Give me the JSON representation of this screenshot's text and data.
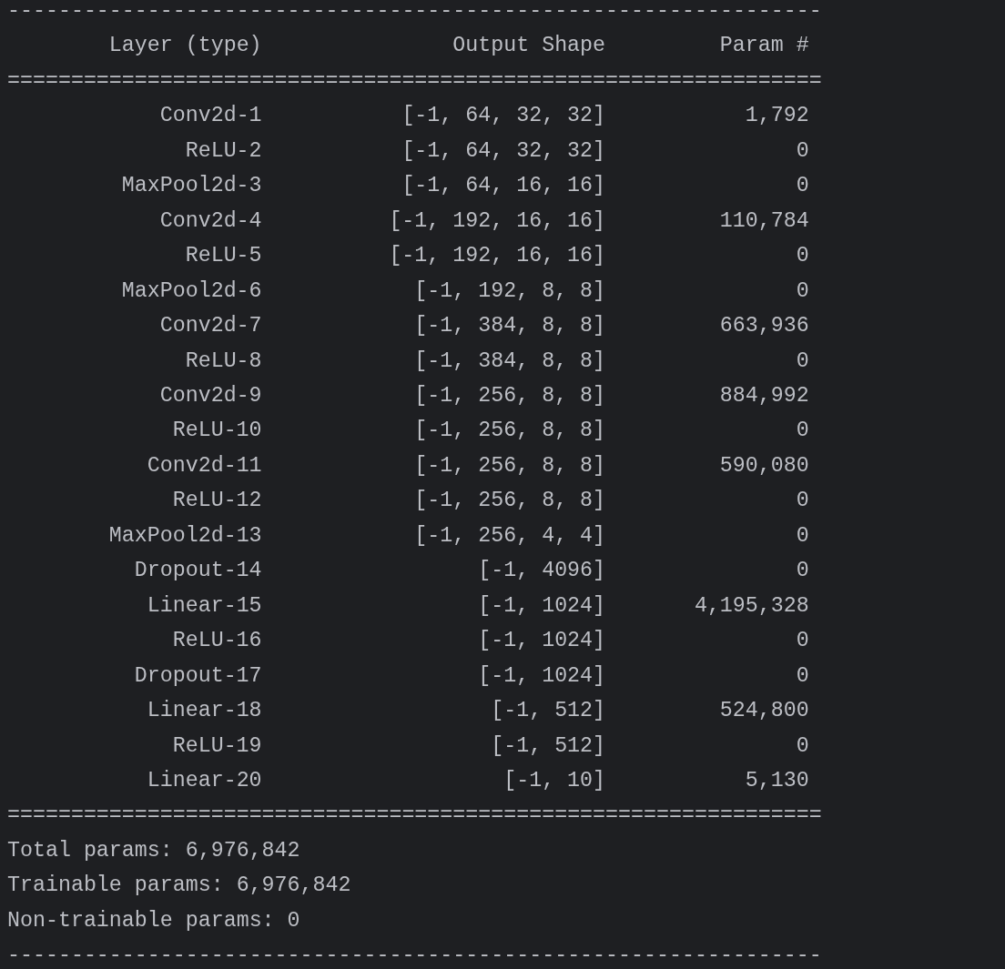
{
  "rule_top": "----------------------------------------------------------------",
  "columns": [
    "Layer (type)",
    "Output Shape",
    "Param #"
  ],
  "rule_header": "================================================================",
  "rows": [
    {
      "layer": "Conv2d-1",
      "shape": "[-1, 64, 32, 32]",
      "params": "1,792"
    },
    {
      "layer": "ReLU-2",
      "shape": "[-1, 64, 32, 32]",
      "params": "0"
    },
    {
      "layer": "MaxPool2d-3",
      "shape": "[-1, 64, 16, 16]",
      "params": "0"
    },
    {
      "layer": "Conv2d-4",
      "shape": "[-1, 192, 16, 16]",
      "params": "110,784"
    },
    {
      "layer": "ReLU-5",
      "shape": "[-1, 192, 16, 16]",
      "params": "0"
    },
    {
      "layer": "MaxPool2d-6",
      "shape": "[-1, 192, 8, 8]",
      "params": "0"
    },
    {
      "layer": "Conv2d-7",
      "shape": "[-1, 384, 8, 8]",
      "params": "663,936"
    },
    {
      "layer": "ReLU-8",
      "shape": "[-1, 384, 8, 8]",
      "params": "0"
    },
    {
      "layer": "Conv2d-9",
      "shape": "[-1, 256, 8, 8]",
      "params": "884,992"
    },
    {
      "layer": "ReLU-10",
      "shape": "[-1, 256, 8, 8]",
      "params": "0"
    },
    {
      "layer": "Conv2d-11",
      "shape": "[-1, 256, 8, 8]",
      "params": "590,080"
    },
    {
      "layer": "ReLU-12",
      "shape": "[-1, 256, 8, 8]",
      "params": "0"
    },
    {
      "layer": "MaxPool2d-13",
      "shape": "[-1, 256, 4, 4]",
      "params": "0"
    },
    {
      "layer": "Dropout-14",
      "shape": "[-1, 4096]",
      "params": "0"
    },
    {
      "layer": "Linear-15",
      "shape": "[-1, 1024]",
      "params": "4,195,328"
    },
    {
      "layer": "ReLU-16",
      "shape": "[-1, 1024]",
      "params": "0"
    },
    {
      "layer": "Dropout-17",
      "shape": "[-1, 1024]",
      "params": "0"
    },
    {
      "layer": "Linear-18",
      "shape": "[-1, 512]",
      "params": "524,800"
    },
    {
      "layer": "ReLU-19",
      "shape": "[-1, 512]",
      "params": "0"
    },
    {
      "layer": "Linear-20",
      "shape": "[-1, 10]",
      "params": "5,130"
    }
  ],
  "rule_footer": "================================================================",
  "summary": [
    "Total params: 6,976,842",
    "Trainable params: 6,976,842",
    "Non-trainable params: 0"
  ],
  "rule_bottom": "----------------------------------------------------------------"
}
